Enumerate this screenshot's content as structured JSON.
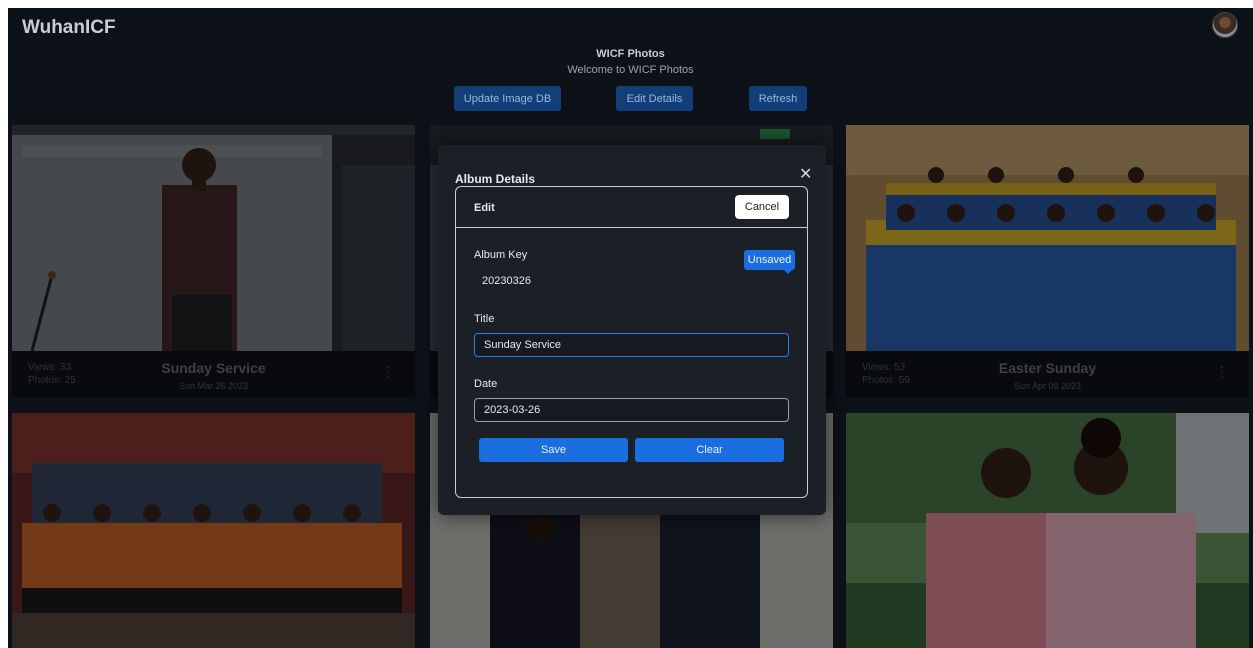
{
  "app": {
    "brand": "WuhanICF"
  },
  "header": {
    "title": "WICF Photos",
    "subtitle": "Welcome to WICF Photos"
  },
  "toolbar": {
    "update_db": "Update Image DB",
    "edit_details": "Edit Details",
    "refresh": "Refresh"
  },
  "albums": [
    {
      "views": "Views: 33",
      "photos": "Photos: 25",
      "title": "Sunday Service",
      "date": "Sun Mar 26 2023"
    },
    {
      "views": "",
      "photos": "",
      "title": "",
      "date": ""
    },
    {
      "views": "Views: 53",
      "photos": "Photos: 59",
      "title": "Easter Sunday",
      "date": "Sun Apr 09 2023"
    }
  ],
  "modal": {
    "title": "Album Details",
    "close_icon": "close-icon",
    "panel_label": "Edit",
    "cancel": "Cancel",
    "status_badge": "Unsaved",
    "album_key_label": "Album Key",
    "album_key_value": "20230326",
    "title_label": "Title",
    "title_value": "Sunday Service",
    "date_label": "Date",
    "date_value": "2023-03-26",
    "save": "Save",
    "clear": "Clear"
  },
  "colors": {
    "background": "#0d1219",
    "accent": "#1a6ee0",
    "button_dark": "#123f7a"
  }
}
